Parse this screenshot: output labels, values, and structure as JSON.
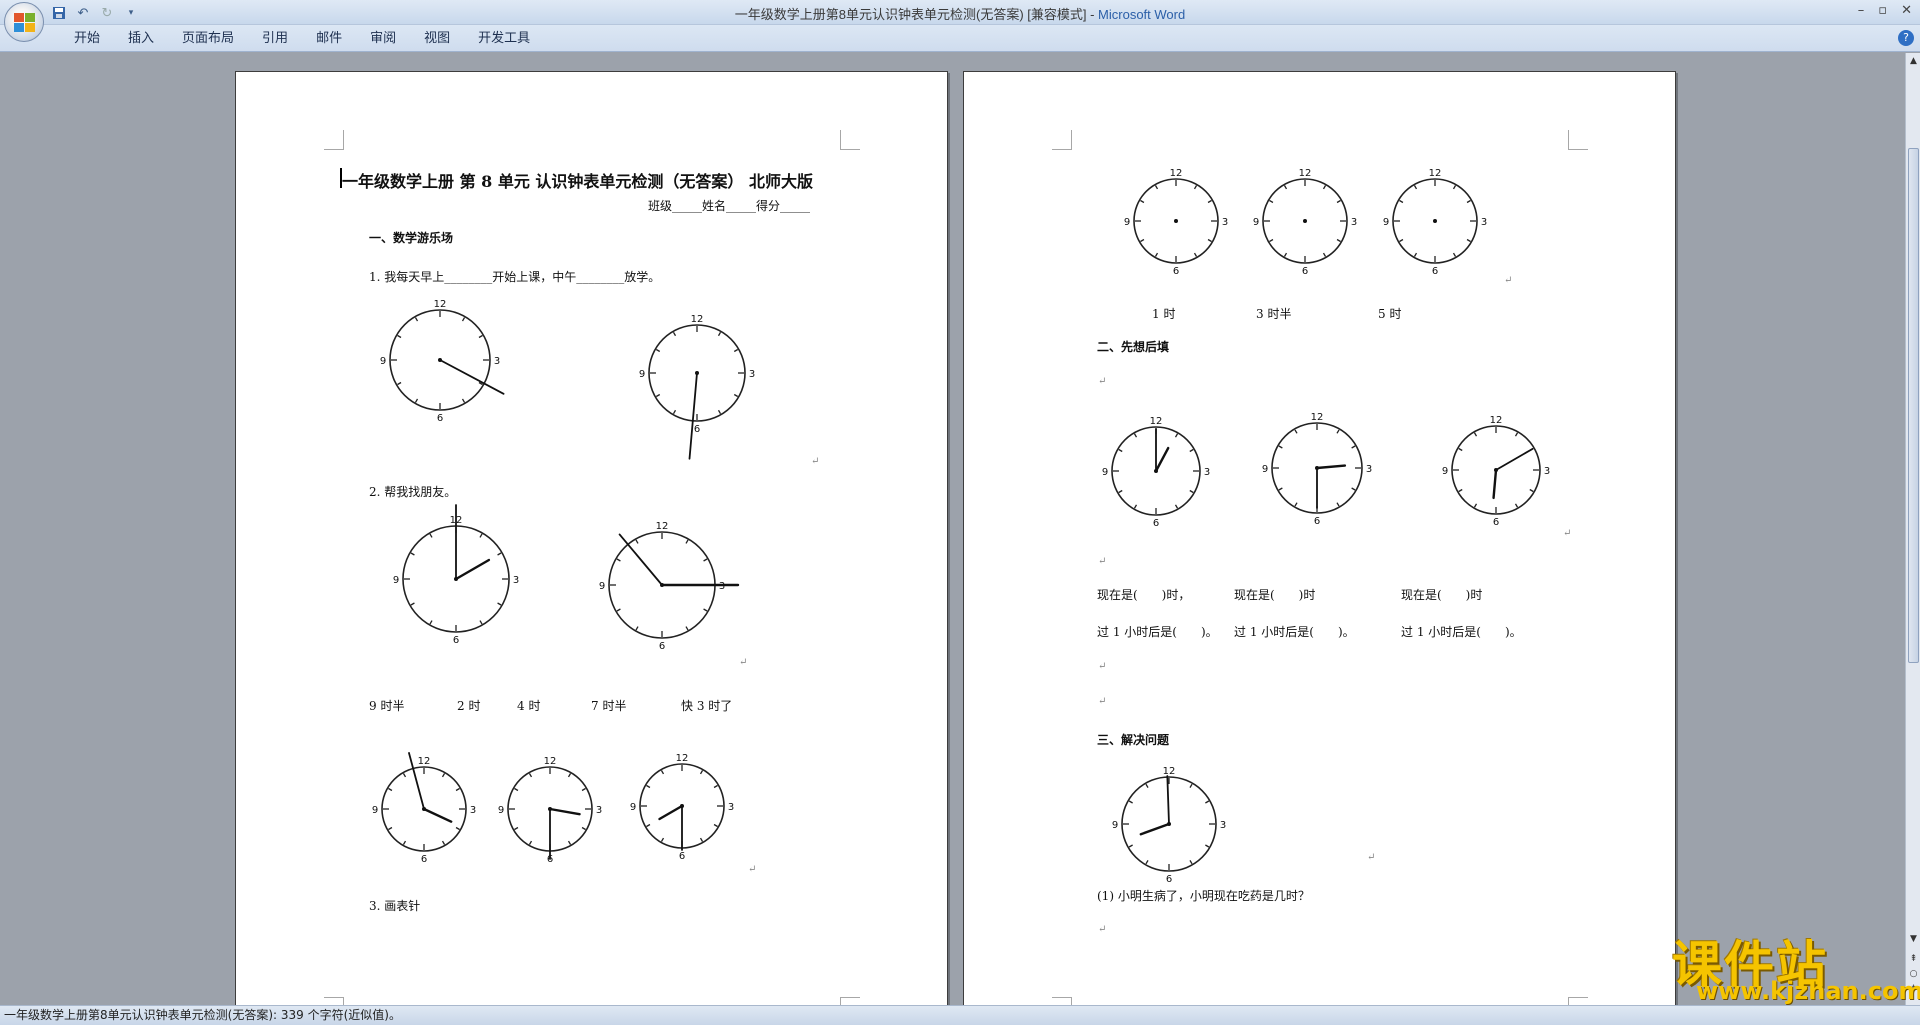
{
  "window": {
    "title_doc": "一年级数学上册第8单元认识钟表单元检测(无答案) [兼容模式] - ",
    "title_app": "Microsoft Word",
    "minimize": "–",
    "restore": "▫",
    "close": "✕"
  },
  "ribbon": {
    "tabs": [
      "开始",
      "插入",
      "页面布局",
      "引用",
      "邮件",
      "审阅",
      "视图",
      "开发工具"
    ]
  },
  "page1": {
    "title": "一年级数学上册 第 8 单元 认识钟表单元检测（无答案） 北师大版",
    "info_line": "班级_____姓名_____得分_____",
    "section1": "一、数学游乐场",
    "q1": "1. 我每天早上________开始上课，中午________放学。",
    "q2": "2. 帮我找朋友。",
    "labels_row": [
      "9 时半",
      "2 时",
      "4 时",
      "7 时半",
      "快 3 时了"
    ],
    "q3": "3. 画表针"
  },
  "page2": {
    "clock_labels": [
      "1 时",
      "3 时半",
      "5 时"
    ],
    "section2": "二、先想后填",
    "now_row": [
      "现在是(　　)时，",
      "现在是(　　)时",
      "现在是(　　)时"
    ],
    "after_row": [
      "过 1 小时后是(　　)。",
      "过 1 小时后是(　　)。",
      "过 1 小时后是(　　)。"
    ],
    "section3": "三、解决问题",
    "p1": "(1) 小明生病了，小明现在吃药是几时？"
  },
  "paragraph_mark": "↵",
  "clock_numbers": [
    "12",
    "3",
    "6",
    "9"
  ],
  "status": {
    "text": "一年级数学上册第8单元认识钟表单元检测(无答案): 339 个字符(近似值)。"
  },
  "watermark": {
    "cn": "课件站",
    "url": "www.kjzhan.com"
  }
}
